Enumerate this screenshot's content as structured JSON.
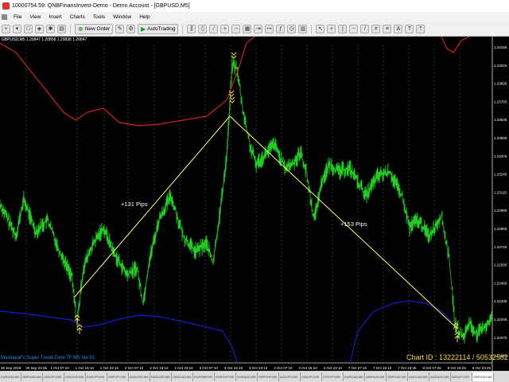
{
  "window": {
    "title": "10000754.59: QNBFinansInvest-Demo - Demo Account - [GBPUSD,M5]"
  },
  "menu": {
    "items": [
      "File",
      "View",
      "Insert",
      "Charts",
      "Tools",
      "Window",
      "Help"
    ]
  },
  "toolbar": {
    "new_order": "New Order",
    "autotrading": "AutoTrading"
  },
  "chart": {
    "symbol_info": "GBPUSD,M5  1.20847 1.20858 1.20838 1.20847",
    "indicator_label": "MaskayaFx Super Trend Zone TF:M5 Ver:01",
    "chart_id": "Chart ID : 13222114 / 50532582",
    "pips_up": "+131 Pips",
    "pips_down": "+153 Pips",
    "colors": {
      "price": "#22cc22",
      "upper_band": "#cc2222",
      "lower_band": "#1a1acc",
      "trend_line": "#ffff66",
      "arrow": "#ffd84a"
    }
  },
  "chart_data": {
    "type": "line",
    "y_ticks": [
      "1.24155",
      "1.24025",
      "1.23895",
      "1.23765",
      "1.23635",
      "1.23505",
      "1.23375",
      "1.23245",
      "1.23115",
      "1.22985",
      "1.22855",
      "1.22725",
      "1.22595",
      "1.22465",
      "1.22335",
      "1.22205",
      "1.22075",
      "1.21945"
    ],
    "x_ticks": [
      "30 Sep 2019",
      "30 Sep 23:35",
      "1 Oct 07:10",
      "1 Oct 15:10",
      "1 Oct 23:10",
      "2 Oct 07:10",
      "2 Oct 15:10",
      "2 Oct 23:10",
      "3 Oct 07:10",
      "3 Oct 15:10",
      "3 Oct 23:10",
      "4 Oct 07:10",
      "4 Oct 15:10",
      "4 Oct 23:10",
      "7 Oct 07:10",
      "7 Oct 15:10",
      "7 Oct 23:25",
      "8 Oct 07:25",
      "8 Oct 15:25",
      "9 Oct 23:25"
    ]
  },
  "tabs": [
    "EURUSD,M5",
    "GBPUSD,M5",
    "USDJPY,M5",
    "USDCHF,M5",
    "EURJPY,M5",
    "GBPJPY,M5",
    "AUDUSD,M5",
    "NZDUSD,M5",
    "USDCAD,M5",
    "EURGBP,M5",
    "EURCHF,M5",
    "EURAUD,M5",
    "GBPCHF,M5",
    "AUDJPY,M5",
    "CADJPY,M5",
    "CHFJPY,M5",
    "EURCAD,M5",
    "GBPAUD,M5",
    "GBPCAD,M5",
    "AUDCAD,M5",
    "AUDNZD,M5",
    "NZDJPY,M5",
    "GBPUSD,M5"
  ]
}
